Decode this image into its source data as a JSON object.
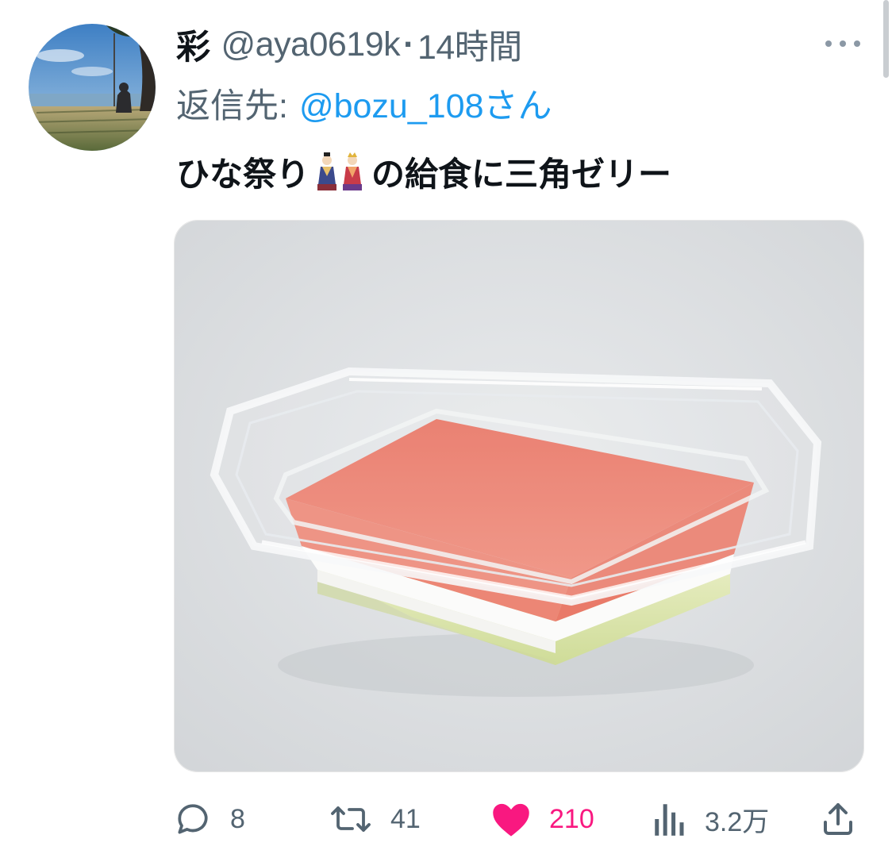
{
  "tweet": {
    "display_name": "彩",
    "handle": "@aya0619k",
    "separator": "·",
    "time": "14時間",
    "reply_label": "返信先:",
    "reply_target": "@bozu_108さん",
    "text_before_emoji": "ひな祭り",
    "emoji": "hina-dolls-emoji",
    "text_after_emoji": "の給食に三角ゼリー",
    "media": "photo-triangle-jelly-in-plastic-tray"
  },
  "actions": {
    "reply_count": "8",
    "retweet_count": "41",
    "like_count": "210",
    "views_count": "3.2万"
  },
  "colors": {
    "text_primary": "#0f1419",
    "text_secondary": "#536471",
    "link_blue": "#1d9bf0",
    "like_pink": "#f91880"
  },
  "icons": [
    "more-icon",
    "reply-icon",
    "retweet-icon",
    "like-icon",
    "views-icon",
    "share-icon"
  ]
}
